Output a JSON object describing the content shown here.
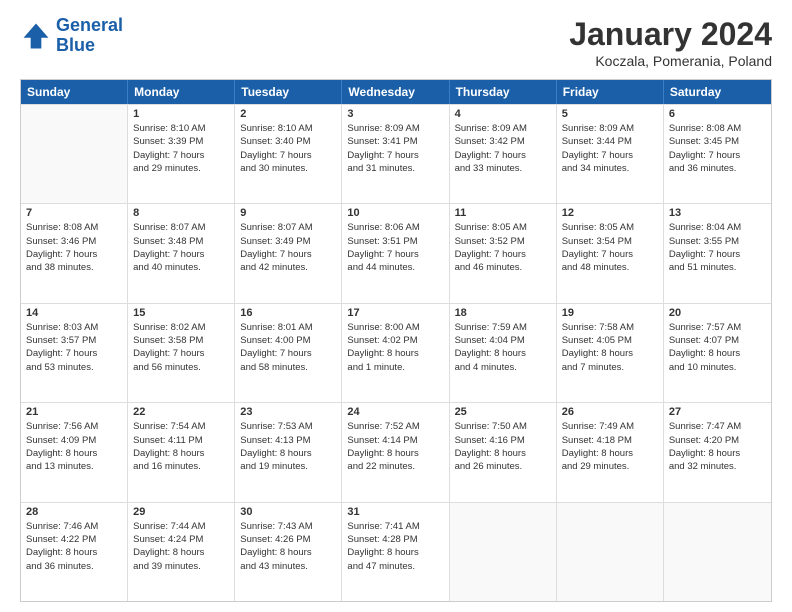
{
  "header": {
    "logo_line1": "General",
    "logo_line2": "Blue",
    "title": "January 2024",
    "subtitle": "Koczala, Pomerania, Poland"
  },
  "calendar": {
    "days_of_week": [
      "Sunday",
      "Monday",
      "Tuesday",
      "Wednesday",
      "Thursday",
      "Friday",
      "Saturday"
    ],
    "rows": [
      [
        {
          "day": "",
          "detail": ""
        },
        {
          "day": "1",
          "detail": "Sunrise: 8:10 AM\nSunset: 3:39 PM\nDaylight: 7 hours\nand 29 minutes."
        },
        {
          "day": "2",
          "detail": "Sunrise: 8:10 AM\nSunset: 3:40 PM\nDaylight: 7 hours\nand 30 minutes."
        },
        {
          "day": "3",
          "detail": "Sunrise: 8:09 AM\nSunset: 3:41 PM\nDaylight: 7 hours\nand 31 minutes."
        },
        {
          "day": "4",
          "detail": "Sunrise: 8:09 AM\nSunset: 3:42 PM\nDaylight: 7 hours\nand 33 minutes."
        },
        {
          "day": "5",
          "detail": "Sunrise: 8:09 AM\nSunset: 3:44 PM\nDaylight: 7 hours\nand 34 minutes."
        },
        {
          "day": "6",
          "detail": "Sunrise: 8:08 AM\nSunset: 3:45 PM\nDaylight: 7 hours\nand 36 minutes."
        }
      ],
      [
        {
          "day": "7",
          "detail": "Sunrise: 8:08 AM\nSunset: 3:46 PM\nDaylight: 7 hours\nand 38 minutes."
        },
        {
          "day": "8",
          "detail": "Sunrise: 8:07 AM\nSunset: 3:48 PM\nDaylight: 7 hours\nand 40 minutes."
        },
        {
          "day": "9",
          "detail": "Sunrise: 8:07 AM\nSunset: 3:49 PM\nDaylight: 7 hours\nand 42 minutes."
        },
        {
          "day": "10",
          "detail": "Sunrise: 8:06 AM\nSunset: 3:51 PM\nDaylight: 7 hours\nand 44 minutes."
        },
        {
          "day": "11",
          "detail": "Sunrise: 8:05 AM\nSunset: 3:52 PM\nDaylight: 7 hours\nand 46 minutes."
        },
        {
          "day": "12",
          "detail": "Sunrise: 8:05 AM\nSunset: 3:54 PM\nDaylight: 7 hours\nand 48 minutes."
        },
        {
          "day": "13",
          "detail": "Sunrise: 8:04 AM\nSunset: 3:55 PM\nDaylight: 7 hours\nand 51 minutes."
        }
      ],
      [
        {
          "day": "14",
          "detail": "Sunrise: 8:03 AM\nSunset: 3:57 PM\nDaylight: 7 hours\nand 53 minutes."
        },
        {
          "day": "15",
          "detail": "Sunrise: 8:02 AM\nSunset: 3:58 PM\nDaylight: 7 hours\nand 56 minutes."
        },
        {
          "day": "16",
          "detail": "Sunrise: 8:01 AM\nSunset: 4:00 PM\nDaylight: 7 hours\nand 58 minutes."
        },
        {
          "day": "17",
          "detail": "Sunrise: 8:00 AM\nSunset: 4:02 PM\nDaylight: 8 hours\nand 1 minute."
        },
        {
          "day": "18",
          "detail": "Sunrise: 7:59 AM\nSunset: 4:04 PM\nDaylight: 8 hours\nand 4 minutes."
        },
        {
          "day": "19",
          "detail": "Sunrise: 7:58 AM\nSunset: 4:05 PM\nDaylight: 8 hours\nand 7 minutes."
        },
        {
          "day": "20",
          "detail": "Sunrise: 7:57 AM\nSunset: 4:07 PM\nDaylight: 8 hours\nand 10 minutes."
        }
      ],
      [
        {
          "day": "21",
          "detail": "Sunrise: 7:56 AM\nSunset: 4:09 PM\nDaylight: 8 hours\nand 13 minutes."
        },
        {
          "day": "22",
          "detail": "Sunrise: 7:54 AM\nSunset: 4:11 PM\nDaylight: 8 hours\nand 16 minutes."
        },
        {
          "day": "23",
          "detail": "Sunrise: 7:53 AM\nSunset: 4:13 PM\nDaylight: 8 hours\nand 19 minutes."
        },
        {
          "day": "24",
          "detail": "Sunrise: 7:52 AM\nSunset: 4:14 PM\nDaylight: 8 hours\nand 22 minutes."
        },
        {
          "day": "25",
          "detail": "Sunrise: 7:50 AM\nSunset: 4:16 PM\nDaylight: 8 hours\nand 26 minutes."
        },
        {
          "day": "26",
          "detail": "Sunrise: 7:49 AM\nSunset: 4:18 PM\nDaylight: 8 hours\nand 29 minutes."
        },
        {
          "day": "27",
          "detail": "Sunrise: 7:47 AM\nSunset: 4:20 PM\nDaylight: 8 hours\nand 32 minutes."
        }
      ],
      [
        {
          "day": "28",
          "detail": "Sunrise: 7:46 AM\nSunset: 4:22 PM\nDaylight: 8 hours\nand 36 minutes."
        },
        {
          "day": "29",
          "detail": "Sunrise: 7:44 AM\nSunset: 4:24 PM\nDaylight: 8 hours\nand 39 minutes."
        },
        {
          "day": "30",
          "detail": "Sunrise: 7:43 AM\nSunset: 4:26 PM\nDaylight: 8 hours\nand 43 minutes."
        },
        {
          "day": "31",
          "detail": "Sunrise: 7:41 AM\nSunset: 4:28 PM\nDaylight: 8 hours\nand 47 minutes."
        },
        {
          "day": "",
          "detail": ""
        },
        {
          "day": "",
          "detail": ""
        },
        {
          "day": "",
          "detail": ""
        }
      ]
    ]
  }
}
